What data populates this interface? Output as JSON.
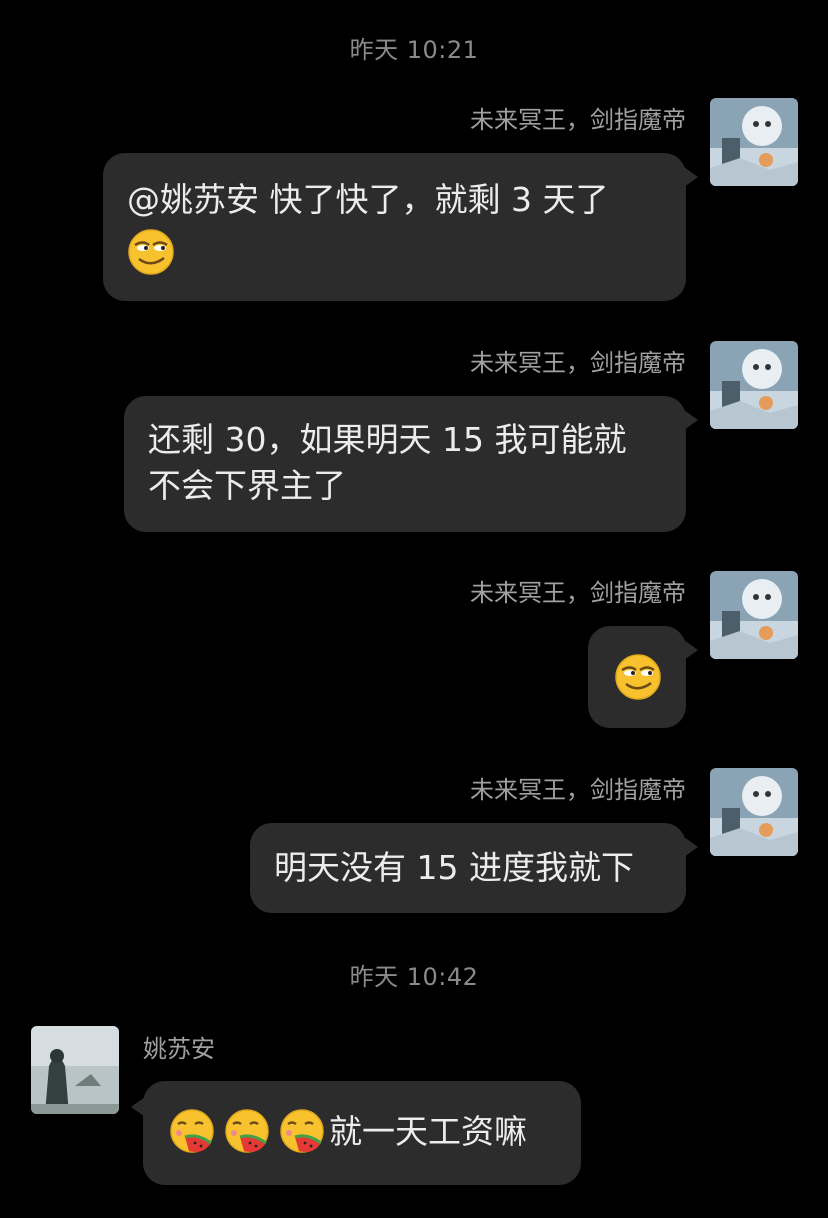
{
  "timestamps": [
    "昨天 10:21",
    "昨天 10:42"
  ],
  "messages": [
    {
      "sender": "未来冥王，剑指魔帝",
      "text": "@姚苏安 快了快了，就剩 3 天了",
      "emoji": "smirk-emoji"
    },
    {
      "sender": "未来冥王，剑指魔帝",
      "text": "还剩 30，如果明天 15 我可能就\n不会下界主了"
    },
    {
      "sender": "未来冥王，剑指魔帝",
      "emoji": "smirk-emoji"
    },
    {
      "sender": "未来冥王，剑指魔帝",
      "text": "明天没有 15 进度我就下"
    },
    {
      "sender": "姚苏安",
      "emoji": "watermelon-emoji",
      "text": "就一天工资嘛"
    }
  ],
  "colors": {
    "background": "#000000",
    "bubble": "#2c2c2c",
    "text": "#ececec",
    "meta": "#8a8a8a"
  }
}
